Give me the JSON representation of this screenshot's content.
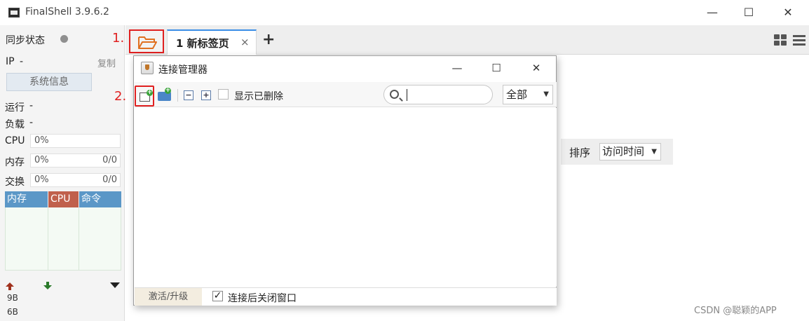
{
  "window": {
    "title": "FinalShell 3.9.6.2",
    "minimize": "—",
    "maximize": "☐",
    "close": "✕"
  },
  "sidebar": {
    "sync_status": "同步状态",
    "ip_label": "IP",
    "ip_value": "-",
    "copy": "复制",
    "sysinfo_button": "系统信息",
    "run_label": "运行",
    "run_value": "-",
    "load_label": "负载",
    "load_value": "-",
    "cpu_label": "CPU",
    "cpu_value": "0%",
    "mem_label": "内存",
    "mem_value": "0%",
    "mem_ratio": "0/0",
    "swap_label": "交换",
    "swap_value": "0%",
    "swap_ratio": "0/0",
    "proc_headers": [
      "内存",
      "CPU",
      "命令"
    ],
    "net_up_icon": "arrow-up-icon",
    "net_down_icon": "arrow-down-icon",
    "net_rates": [
      "9B",
      "6B"
    ],
    "colors": {
      "mem_header": "#5b97c7",
      "cpu_header": "#c0604c",
      "cmd_header": "#5b97c7"
    }
  },
  "tabs": {
    "items": [
      {
        "label": "1 新标签页",
        "close": "×"
      }
    ],
    "add": "+"
  },
  "annotations": [
    "1.",
    "2."
  ],
  "sort": {
    "label": "排序",
    "value": "访问时间"
  },
  "dialog": {
    "title": "连接管理器",
    "minimize": "—",
    "maximize": "☐",
    "close": "✕",
    "show_deleted": "显示已删除",
    "search_value": "",
    "scope": "全部",
    "activate": "激活/升级",
    "close_after_connect": "连接后关闭窗口",
    "close_after_connect_checked": true
  },
  "watermark": "CSDN @聪颖的APP"
}
